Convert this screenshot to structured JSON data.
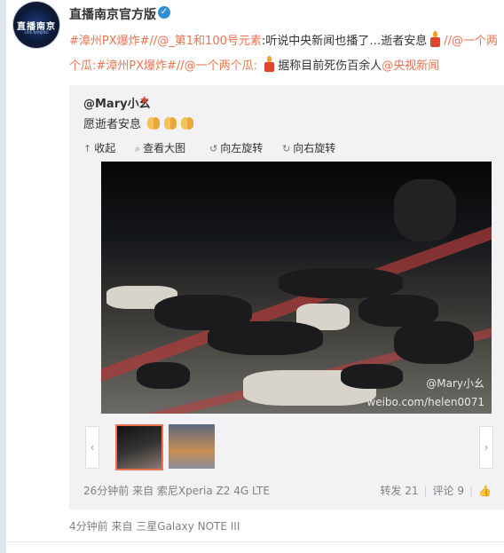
{
  "post": {
    "author": "直播南京官方版",
    "avatar_text": "直播南京",
    "avatar_sub": "LIVE NANJING",
    "line1": [
      {
        "t": "#漳州PX爆炸#//@_第1和100号元素",
        "c": "orange"
      },
      {
        "t": ":听说中央新闻也播了…逝者安息",
        "c": "plain"
      },
      {
        "t": "//@一个两",
        "c": "orange"
      }
    ],
    "line2": [
      {
        "t": "个瓜:#漳州PX爆炸#//@一个两个瓜:",
        "c": "orange"
      },
      {
        "t": "据称目前死伤百余人",
        "c": "plain"
      },
      {
        "t": "@央视新闻",
        "c": "orange"
      }
    ],
    "footer_text": "4分钟前 来自 三星Galaxy NOTE III"
  },
  "repost": {
    "user": "@Mary小幺",
    "text": "愿逝者安息",
    "toolbar": {
      "collapse": "收起",
      "view_large": "查看大图",
      "rotate_left": "向左旋转",
      "rotate_right": "向右旋转"
    },
    "watermark1": "@Mary小幺",
    "watermark2": "weibo.com/helen0071",
    "footer_source": "26分钟前 来自 索尼Xperia Z2 4G LTE",
    "repost_label": "转发 21",
    "comment_label": "评论 9"
  },
  "icons": {
    "verify": "verified-badge-icon",
    "candle": "candle-icon",
    "pray": "praying-hands-icon",
    "like": "thumbs-up-icon"
  },
  "colors": {
    "link": "#eb7350",
    "verify": "#2d8fd5",
    "panel": "#f2f2f5"
  }
}
